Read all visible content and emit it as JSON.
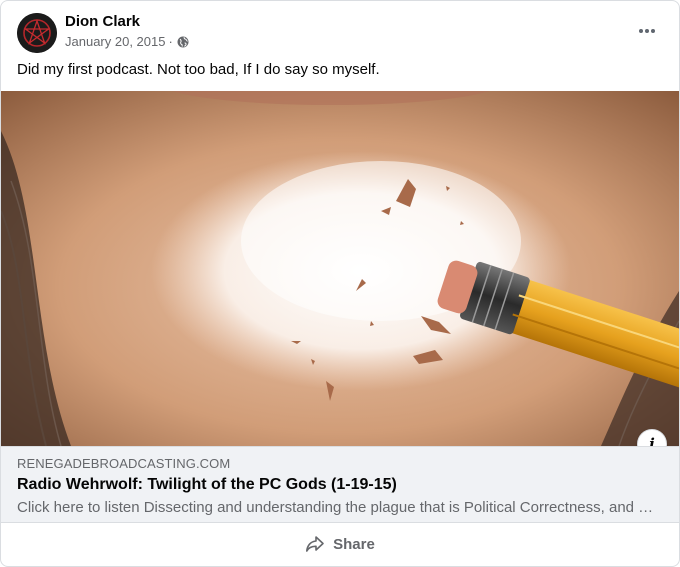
{
  "post": {
    "author": "Dion Clark",
    "date": "January 20, 2015",
    "separator": "·",
    "privacy_icon": "globe-icon",
    "more_icon": "more-options-icon",
    "text": "Did my first podcast. Not too bad, If I do say so myself."
  },
  "link_preview": {
    "domain": "RENEGADEBROADCASTING.COM",
    "title": "Radio Wehrwolf: Twilight of the PC Gods (1-19-15)",
    "description": "Click here to listen Dissecting and understanding the plague that is Political Correctness, and …",
    "info_label": "i"
  },
  "actions": {
    "share_label": "Share",
    "share_icon": "share-arrow-icon"
  },
  "colors": {
    "secondary_text": "#65676b",
    "link_box_bg": "#f0f2f5",
    "border": "#dadde1"
  }
}
